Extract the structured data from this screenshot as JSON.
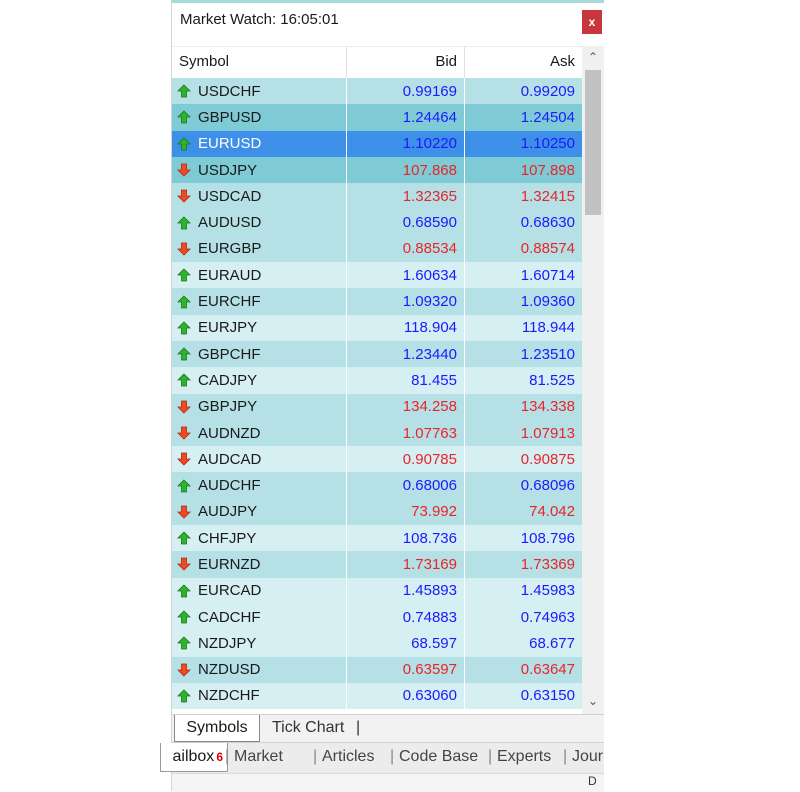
{
  "window": {
    "title": "Market Watch: 16:05:01",
    "close_label": "x"
  },
  "columns": {
    "symbol": "Symbol",
    "bid": "Bid",
    "ask": "Ask"
  },
  "colors": {
    "up": "#1a1aff",
    "down": "#e8252b",
    "selected_bg": "#3d8fe8",
    "dark_bg": "#7ecbd6",
    "light_bg": "#b5e0e6",
    "pale_bg": "#d5eff2"
  },
  "rows": [
    {
      "symbol": "USDCHF",
      "bid": "0.99169",
      "ask": "0.99209",
      "dir": "up",
      "bg": "light"
    },
    {
      "symbol": "GBPUSD",
      "bid": "1.24464",
      "ask": "1.24504",
      "dir": "up",
      "bg": "dark"
    },
    {
      "symbol": "EURUSD",
      "bid": "1.10220",
      "ask": "1.10250",
      "dir": "up",
      "bg": "selected"
    },
    {
      "symbol": "USDJPY",
      "bid": "107.868",
      "ask": "107.898",
      "dir": "down",
      "bg": "dark"
    },
    {
      "symbol": "USDCAD",
      "bid": "1.32365",
      "ask": "1.32415",
      "dir": "down",
      "bg": "light"
    },
    {
      "symbol": "AUDUSD",
      "bid": "0.68590",
      "ask": "0.68630",
      "dir": "up",
      "bg": "light"
    },
    {
      "symbol": "EURGBP",
      "bid": "0.88534",
      "ask": "0.88574",
      "dir": "down",
      "bg": "light"
    },
    {
      "symbol": "EURAUD",
      "bid": "1.60634",
      "ask": "1.60714",
      "dir": "up",
      "bg": "pale"
    },
    {
      "symbol": "EURCHF",
      "bid": "1.09320",
      "ask": "1.09360",
      "dir": "up",
      "bg": "light"
    },
    {
      "symbol": "EURJPY",
      "bid": "118.904",
      "ask": "118.944",
      "dir": "up",
      "bg": "pale"
    },
    {
      "symbol": "GBPCHF",
      "bid": "1.23440",
      "ask": "1.23510",
      "dir": "up",
      "bg": "light"
    },
    {
      "symbol": "CADJPY",
      "bid": "81.455",
      "ask": "81.525",
      "dir": "up",
      "bg": "pale"
    },
    {
      "symbol": "GBPJPY",
      "bid": "134.258",
      "ask": "134.338",
      "dir": "down",
      "bg": "light"
    },
    {
      "symbol": "AUDNZD",
      "bid": "1.07763",
      "ask": "1.07913",
      "dir": "down",
      "bg": "light"
    },
    {
      "symbol": "AUDCAD",
      "bid": "0.90785",
      "ask": "0.90875",
      "dir": "down",
      "bg": "pale"
    },
    {
      "symbol": "AUDCHF",
      "bid": "0.68006",
      "ask": "0.68096",
      "dir": "up",
      "bg": "light"
    },
    {
      "symbol": "AUDJPY",
      "bid": "73.992",
      "ask": "74.042",
      "dir": "down",
      "bg": "light"
    },
    {
      "symbol": "CHFJPY",
      "bid": "108.736",
      "ask": "108.796",
      "dir": "up",
      "bg": "pale"
    },
    {
      "symbol": "EURNZD",
      "bid": "1.73169",
      "ask": "1.73369",
      "dir": "down",
      "bg": "light"
    },
    {
      "symbol": "EURCAD",
      "bid": "1.45893",
      "ask": "1.45983",
      "dir": "up",
      "bg": "pale"
    },
    {
      "symbol": "CADCHF",
      "bid": "0.74883",
      "ask": "0.74963",
      "dir": "up",
      "bg": "pale"
    },
    {
      "symbol": "NZDJPY",
      "bid": "68.597",
      "ask": "68.677",
      "dir": "up",
      "bg": "pale"
    },
    {
      "symbol": "NZDUSD",
      "bid": "0.63597",
      "ask": "0.63647",
      "dir": "down",
      "bg": "light"
    },
    {
      "symbol": "NZDCHF",
      "bid": "0.63060",
      "ask": "0.63150",
      "dir": "up",
      "bg": "pale"
    }
  ],
  "tabs": {
    "symbols": "Symbols",
    "tick_chart": "Tick Chart",
    "separator": "|"
  },
  "bottom_tabs": [
    {
      "label": "ailbox",
      "badge": "6"
    },
    {
      "label": "Market"
    },
    {
      "label": "Articles"
    },
    {
      "label": "Code Base"
    },
    {
      "label": "Experts"
    },
    {
      "label": "Jour"
    }
  ],
  "strip_char": "D"
}
